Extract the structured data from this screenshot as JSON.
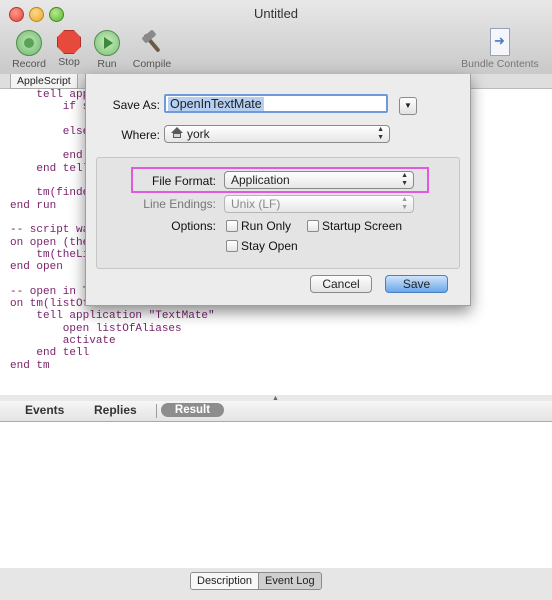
{
  "window": {
    "title": "Untitled"
  },
  "toolbar": {
    "record": "Record",
    "stop": "Stop",
    "run": "Run",
    "compile": "Compile",
    "bundle_contents": "Bundle Contents"
  },
  "editor": {
    "tab": "AppleScript",
    "code": "    tell appl\n        if s\n\n        else\n\n        end i\n    end tell\n\n    tm(finde\nend run\n\n-- script wa\non open (the\n    tm(theLi\nend open\n\n-- open in T\non tm(listOf\n    tell application \"TextMate\"\n        open listOfAliases\n        activate\n    end tell\nend tm"
  },
  "bottom_tabs": {
    "events": "Events",
    "replies": "Replies",
    "result": "Result"
  },
  "footer": {
    "description": "Description",
    "event_log": "Event Log"
  },
  "save_sheet": {
    "save_as_label": "Save As:",
    "save_as_value": "OpenInTextMate",
    "where_label": "Where:",
    "where_value": "york",
    "file_format_label": "File Format:",
    "file_format_value": "Application",
    "line_endings_label": "Line Endings:",
    "line_endings_value": "Unix (LF)",
    "options_label": "Options:",
    "run_only": "Run Only",
    "startup_screen": "Startup Screen",
    "stay_open": "Stay Open",
    "cancel": "Cancel",
    "save": "Save"
  },
  "colors": {
    "code_text": "#7a1f6b",
    "highlight_border": "#e05ae0",
    "save_button": "#6aa6ea",
    "selection": "#b5d0f3"
  }
}
